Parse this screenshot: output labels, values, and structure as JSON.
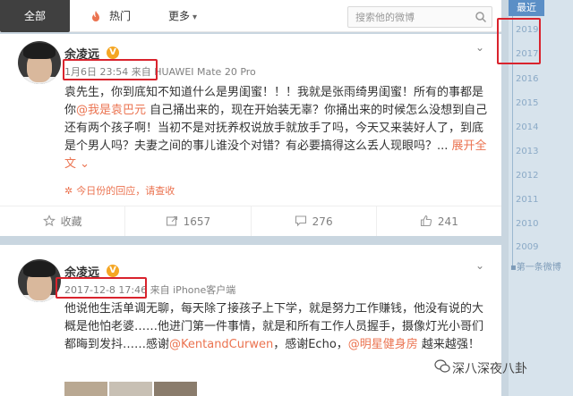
{
  "nav": {
    "tab_all": "全部",
    "tab_hot": "热门",
    "tab_more": "更多",
    "search_placeholder": "搜索他的微博"
  },
  "posts": [
    {
      "author": "余凌远",
      "badge": "V",
      "time": "1月6日 23:54",
      "source_prefix": "来自",
      "source": "HUAWEI Mate 20 Pro",
      "text_parts": [
        "袁先生，你到底知不知道什么是男闺蜜！！！我就是张雨绮男闺蜜！所有的事都是你",
        "@我是袁巴元",
        " 自己捅出来的，现在开始装无辜？你捅出来的时候怎么没想到自己还有两个孩子啊！当初不是对抚养权说放手就放手了吗，今天又来装好人了，到底是个男人吗？夫妻之间的事儿谁没个对错？有必要搞得这么丢人现眼吗？..."
      ],
      "expand": "展开全文",
      "today_review": "今日份的回应，请查收",
      "actions": {
        "favorite": "收藏",
        "share": "1657",
        "comment": "276",
        "like": "241"
      }
    },
    {
      "author": "余凌远",
      "badge": "V",
      "time": "2017-12-8 17:46",
      "source_prefix": "来自",
      "source": "iPhone客户端",
      "text_parts": [
        "他说他生活单调无聊，每天除了接孩子上下学，就是努力工作赚钱，他没有说的大概是他怕老婆……他进门第一件事情，就是和所有工作人员握手，摄像灯光小哥们都晦到发抖……感谢",
        "@KentandCurwen",
        "，感谢Echo，",
        "@明星健身房",
        " 越来越强！"
      ]
    }
  ],
  "timeline": {
    "latest": "最近",
    "years": [
      "2019",
      "2017",
      "2016",
      "2015",
      "2014",
      "2013",
      "2012",
      "2011",
      "2010",
      "2009"
    ],
    "first": "第一条微博"
  },
  "watermark": "深八深夜八卦",
  "colors": {
    "accent": "#eb7350",
    "highlight_box": "#d9232d",
    "nav_active": "#404040",
    "timeline_active": "#5b8fc6"
  }
}
